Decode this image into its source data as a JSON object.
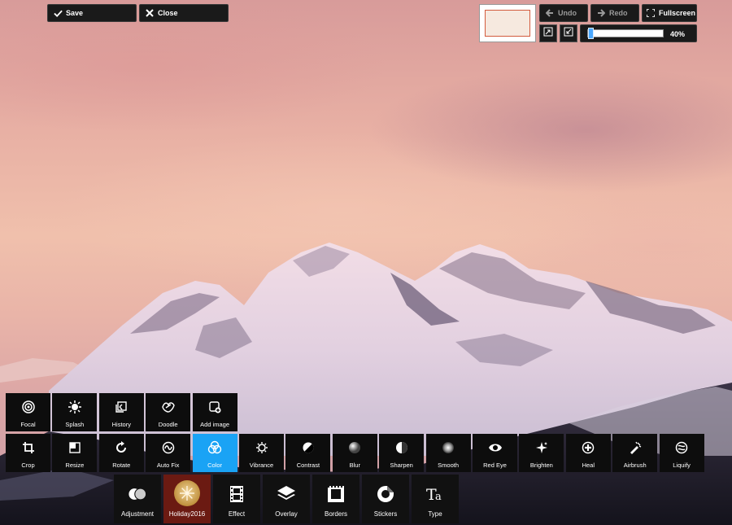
{
  "toolbar": {
    "save_label": "Save",
    "close_label": "Close",
    "undo_label": "Undo",
    "redo_label": "Redo",
    "fullscreen_label": "Fullscreen",
    "zoom_value": "40%",
    "zoom_fraction": 0.03
  },
  "tools_row1": [
    {
      "label": "Focal",
      "icon": "focal-icon"
    },
    {
      "label": "Splash",
      "icon": "splash-icon"
    },
    {
      "label": "History",
      "icon": "history-icon"
    },
    {
      "label": "Doodle",
      "icon": "doodle-icon"
    },
    {
      "label": "Add image",
      "icon": "add-image-icon"
    }
  ],
  "tools_row2": [
    {
      "label": "Crop",
      "icon": "crop-icon"
    },
    {
      "label": "Resize",
      "icon": "resize-icon"
    },
    {
      "label": "Rotate",
      "icon": "rotate-icon"
    },
    {
      "label": "Auto Fix",
      "icon": "auto-fix-icon"
    },
    {
      "label": "Color",
      "icon": "color-icon",
      "active": true
    },
    {
      "label": "Vibrance",
      "icon": "vibrance-icon"
    },
    {
      "label": "Contrast",
      "icon": "contrast-icon"
    },
    {
      "label": "Blur",
      "icon": "blur-icon"
    },
    {
      "label": "Sharpen",
      "icon": "sharpen-icon"
    },
    {
      "label": "Smooth",
      "icon": "smooth-icon"
    },
    {
      "label": "Red Eye",
      "icon": "red-eye-icon"
    },
    {
      "label": "Brighten",
      "icon": "brighten-icon"
    },
    {
      "label": "Heal",
      "icon": "heal-icon"
    },
    {
      "label": "Airbrush",
      "icon": "airbrush-icon"
    },
    {
      "label": "Liquify",
      "icon": "liquify-icon"
    }
  ],
  "categories": [
    {
      "label": "Adjustment",
      "icon": "adjustment-icon"
    },
    {
      "label": "Holiday2016",
      "icon": "holiday-icon",
      "active": true
    },
    {
      "label": "Effect",
      "icon": "film-icon"
    },
    {
      "label": "Overlay",
      "icon": "layers-icon"
    },
    {
      "label": "Borders",
      "icon": "border-icon"
    },
    {
      "label": "Stickers",
      "icon": "sticker-icon"
    },
    {
      "label": "Type",
      "icon": "type-icon"
    }
  ],
  "colors": {
    "active_tool": "#1aa3f5",
    "active_category": "#6b1a12",
    "toolbar_bg": "#1a1a1a"
  }
}
